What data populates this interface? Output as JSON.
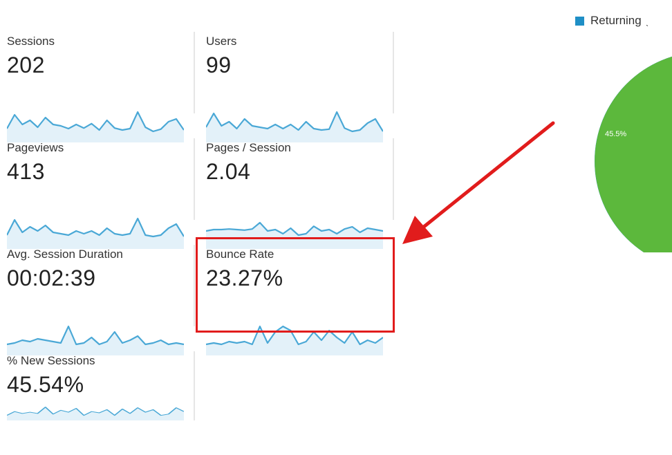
{
  "metrics": [
    {
      "label": "Sessions",
      "value": "202",
      "spark": [
        0.4,
        0.9,
        0.55,
        0.7,
        0.45,
        0.8,
        0.55,
        0.5,
        0.4,
        0.55,
        0.42,
        0.58,
        0.35,
        0.7,
        0.42,
        0.35,
        0.4,
        1.0,
        0.45,
        0.3,
        0.38,
        0.65,
        0.75,
        0.35
      ]
    },
    {
      "label": "Users",
      "value": "99",
      "spark": [
        0.45,
        0.95,
        0.5,
        0.65,
        0.4,
        0.75,
        0.5,
        0.45,
        0.4,
        0.55,
        0.4,
        0.55,
        0.35,
        0.65,
        0.4,
        0.35,
        0.38,
        1.0,
        0.42,
        0.3,
        0.35,
        0.6,
        0.75,
        0.3
      ]
    },
    {
      "label": "Pageviews",
      "value": "413",
      "spark": [
        0.4,
        0.95,
        0.5,
        0.7,
        0.55,
        0.75,
        0.5,
        0.45,
        0.4,
        0.55,
        0.45,
        0.55,
        0.4,
        0.65,
        0.45,
        0.4,
        0.45,
        1.0,
        0.4,
        0.35,
        0.4,
        0.65,
        0.8,
        0.35
      ]
    },
    {
      "label": "Pages / Session",
      "value": "2.04",
      "spark": [
        0.55,
        0.6,
        0.6,
        0.62,
        0.6,
        0.58,
        0.62,
        0.85,
        0.55,
        0.6,
        0.45,
        0.65,
        0.4,
        0.45,
        0.72,
        0.55,
        0.6,
        0.45,
        0.62,
        0.7,
        0.5,
        0.65,
        0.6,
        0.55
      ]
    },
    {
      "label": "Avg. Session Duration",
      "value": "00:02:39",
      "spark": [
        0.3,
        0.35,
        0.45,
        0.4,
        0.5,
        0.45,
        0.4,
        0.35,
        0.95,
        0.3,
        0.35,
        0.55,
        0.3,
        0.4,
        0.75,
        0.35,
        0.45,
        0.6,
        0.3,
        0.35,
        0.45,
        0.3,
        0.35,
        0.3
      ]
    },
    {
      "label": "Bounce Rate",
      "value": "23.27%",
      "spark": [
        0.3,
        0.35,
        0.3,
        0.4,
        0.35,
        0.4,
        0.3,
        0.95,
        0.35,
        0.75,
        0.95,
        0.8,
        0.3,
        0.4,
        0.75,
        0.45,
        0.8,
        0.55,
        0.35,
        0.75,
        0.3,
        0.45,
        0.35,
        0.55
      ]
    },
    {
      "label": "% New Sessions",
      "value": "45.54%",
      "spark": [
        0.3,
        0.6,
        0.45,
        0.55,
        0.45,
        0.95,
        0.4,
        0.7,
        0.55,
        0.85,
        0.3,
        0.6,
        0.5,
        0.75,
        0.3,
        0.8,
        0.45,
        0.9,
        0.55,
        0.75,
        0.3,
        0.4,
        0.9,
        0.6
      ]
    }
  ],
  "legend": {
    "label": "Returning",
    "tick": "ˎ"
  },
  "pie": {
    "label": "45.5%",
    "share": 0.455
  },
  "colors": {
    "line": "#4aa8d6",
    "fill": "#e3f1f9",
    "pie_green": "#5cb83c",
    "pie_blue": "#1f8fc6",
    "highlight": "#e11c1c"
  }
}
